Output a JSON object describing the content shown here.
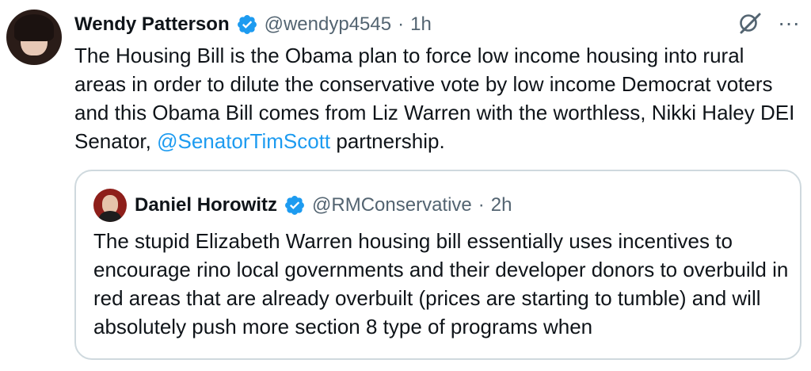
{
  "tweet": {
    "author": {
      "display_name": "Wendy Patterson",
      "handle": "@wendyp4545",
      "verified": true
    },
    "separator": "·",
    "time": "1h",
    "text_before_mention": "The Housing Bill is the Obama plan to force low income housing into rural areas in order to dilute the conservative vote by low income Democrat voters and this Obama Bill comes from Liz Warren with the worthless, Nikki Haley DEI Senator, ",
    "mention": "@SenatorTimScott",
    "text_after_mention": " partnership.",
    "actions": {
      "grok_icon": "grok-icon",
      "more": "···"
    }
  },
  "quote": {
    "author": {
      "display_name": "Daniel Horowitz",
      "handle": "@RMConservative",
      "verified": true
    },
    "separator": "·",
    "time": "2h",
    "text": "The stupid Elizabeth Warren housing bill essentially uses incentives to encourage rino local governments and their developer donors to overbuild in red areas that are already overbuilt (prices are starting to tumble) and will absolutely push more section 8 type of programs when"
  },
  "colors": {
    "text": "#0f1419",
    "secondary": "#536471",
    "link": "#1d9bf0",
    "border": "#cfd9de",
    "verified": "#1d9bf0"
  }
}
